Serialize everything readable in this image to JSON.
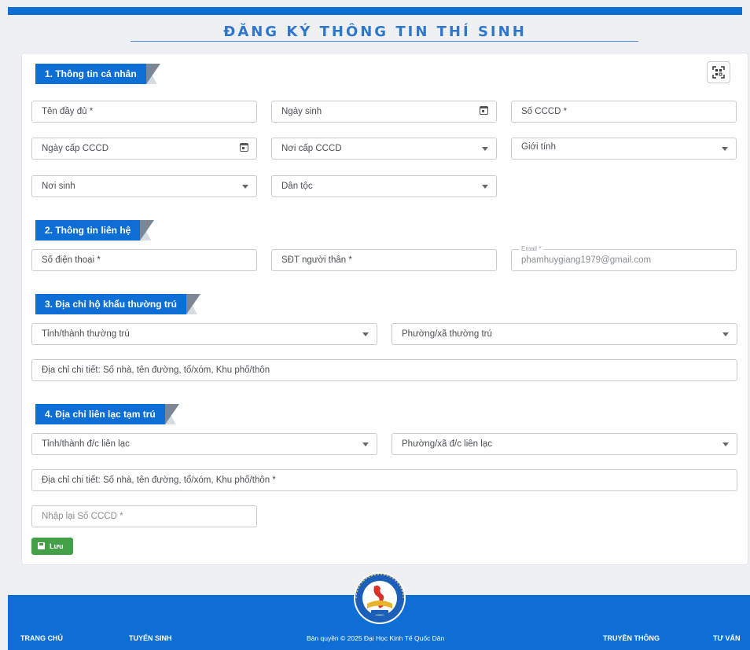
{
  "header": {
    "title": "ĐĂNG KÝ THÔNG TIN THÍ SINH"
  },
  "sections": {
    "personal": {
      "label": "1. Thông tin cá nhân",
      "full_name": "Tên đầy đủ *",
      "birth_date": "Ngày sinh",
      "id_number": "Số CCCD *",
      "id_issue_date": "Ngày cấp CCCD",
      "id_issue_place": "Nơi cấp CCCD",
      "gender": "Giới tính",
      "birth_place": "Nơi sinh",
      "ethnicity": "Dân tộc"
    },
    "contact": {
      "label": "2. Thông tin liên hệ",
      "phone": "Số điện thoại *",
      "relative_phone": "SĐT người thân *",
      "email_label": "Email *",
      "email_value": "phamhuygiang1979@gmail.com"
    },
    "permanent_address": {
      "label": "3. Địa chỉ hộ khẩu thường trú",
      "province": "Tỉnh/thành thường trú",
      "ward": "Phường/xã thường trú",
      "detail": "Địa chỉ chi tiết: Số nhà, tên đường, tổ/xóm, Khu phố/thôn"
    },
    "temporary_address": {
      "label": "4. Địa chỉ liên lạc tạm trú",
      "province": "Tỉnh/thành đ/c liên lạc",
      "ward": "Phường/xã đ/c liên lạc",
      "detail": "Địa chỉ chi tiết: Số nhà, tên đường, tổ/xóm, Khu phố/thôn *"
    },
    "confirm_id": "Nhập lại Số CCCD *"
  },
  "actions": {
    "save_label": "Lưu"
  },
  "footer": {
    "home": "TRANG CHỦ",
    "admissions": "TUYỂN SINH",
    "copyright": "Bản quyền © 2025 Đại Học Kinh Tế Quốc Dân",
    "media": "TRUYỀN THÔNG",
    "consult": "TƯ VẤN"
  },
  "colors": {
    "primary": "#0d6fd6",
    "save": "#43a047"
  }
}
